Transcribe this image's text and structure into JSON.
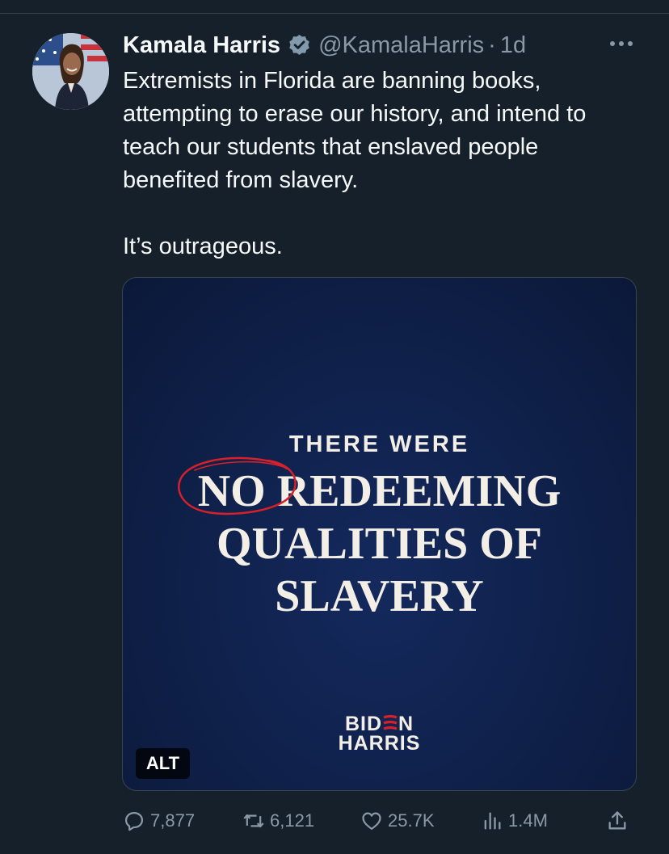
{
  "tweet": {
    "display_name": "Kamala Harris",
    "handle": "@KamalaHarris",
    "separator": "·",
    "time": "1d",
    "text": "Extremists in Florida are banning books, attempting to erase our history, and intend to teach our students that enslaved people benefited from slavery.\n\nIt’s outrageous."
  },
  "media": {
    "kicker": "THERE WERE",
    "headline_no": "NO",
    "headline_line1_rest": "REDEEMING",
    "headline_line2": "QUALITIES OF",
    "headline_line3": "SLAVERY",
    "logo_line1_left": "BID",
    "logo_line1_right": "N",
    "logo_line2": "HARRIS",
    "alt_label": "ALT",
    "circle_color": "#d6202a"
  },
  "actions": {
    "replies": "7,877",
    "retweets": "6,121",
    "likes": "25.7K",
    "views": "1.4M"
  },
  "icons": {
    "more": "more-horizontal-icon",
    "verified": "verified-badge-icon",
    "reply": "reply-icon",
    "retweet": "retweet-icon",
    "like": "heart-icon",
    "views": "analytics-icon",
    "share": "share-icon"
  },
  "colors": {
    "background": "#15202b",
    "text_primary": "#f7f9f9",
    "text_secondary": "#8b98a5",
    "image_background": "#0f2049"
  }
}
